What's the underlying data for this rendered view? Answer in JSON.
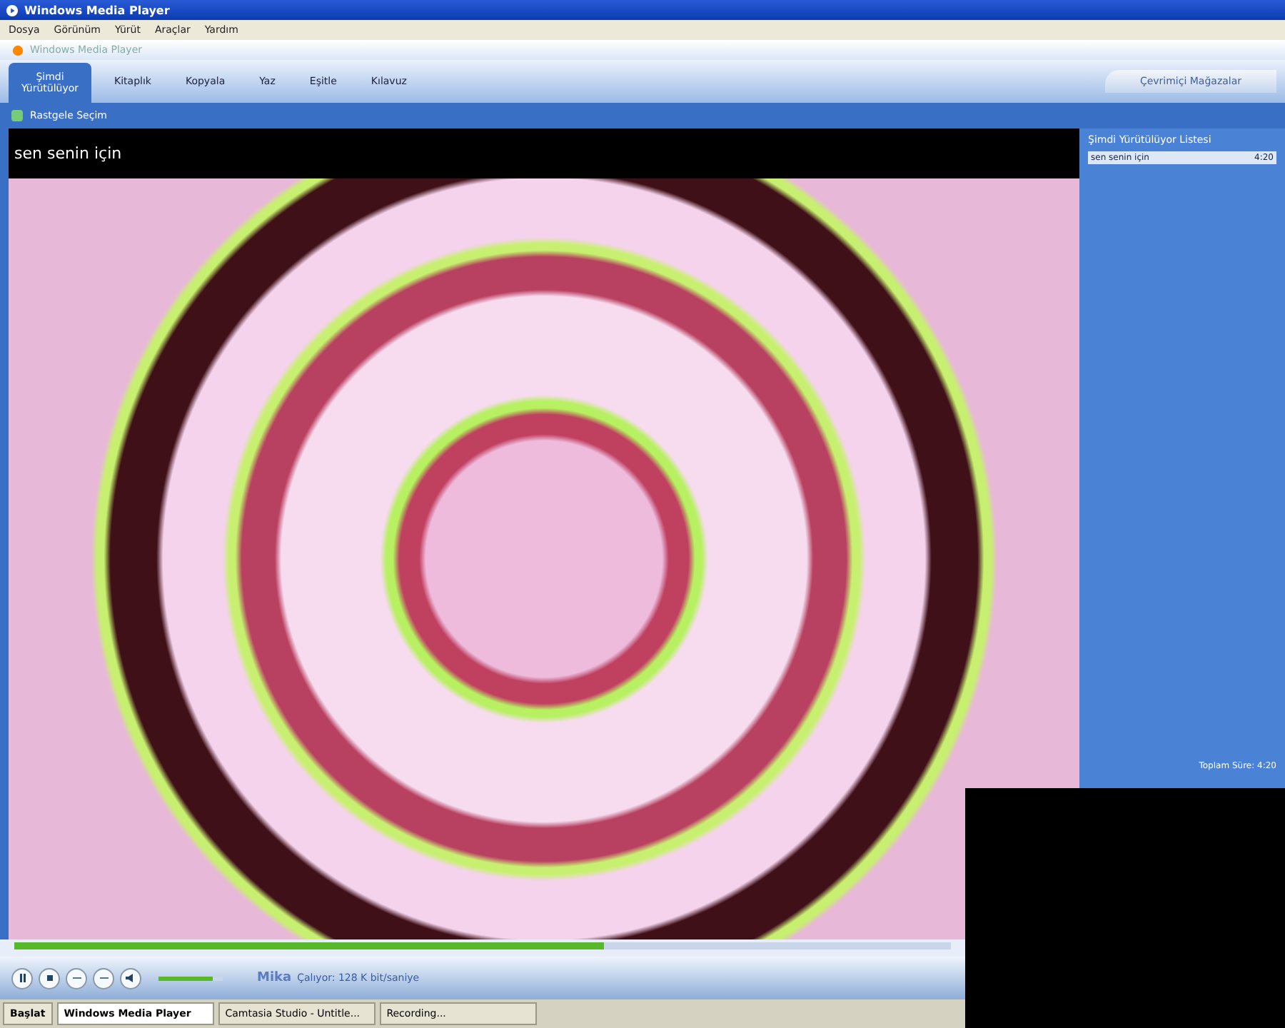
{
  "window": {
    "title": "Windows Media Player"
  },
  "menu": [
    "Dosya",
    "Görünüm",
    "Yürüt",
    "Araçlar",
    "Yardım"
  ],
  "player_title": "Windows Media Player",
  "tabs": [
    {
      "label": "Şimdi Yürütülüyor",
      "selected": true
    },
    {
      "label": "Kitaplık",
      "selected": false
    },
    {
      "label": "Kopyala",
      "selected": false
    },
    {
      "label": "Yaz",
      "selected": false
    },
    {
      "label": "Eşitle",
      "selected": false
    },
    {
      "label": "Kılavuz",
      "selected": false
    }
  ],
  "store_tab": {
    "label": "Çevrimiçi Mağazalar"
  },
  "toolbar": {
    "shuffle_label": "Rastgele Seçim"
  },
  "video": {
    "caption": "sen senin için"
  },
  "playlist": {
    "title": "Şimdi Yürütülüyor Listesi",
    "items": [
      {
        "name": "sen senin için",
        "duration": "4:20",
        "selected": true
      }
    ],
    "total": "Toplam Süre: 4:20"
  },
  "seek": {
    "level": 0.63
  },
  "volume": {
    "level": 0.85
  },
  "status": {
    "artist": "Mika",
    "text": "Çalıyor: 128 K bit/saniye"
  },
  "taskbar": {
    "start": "Başlat",
    "items": [
      {
        "label": "Windows Media Player",
        "selected": true
      },
      {
        "label": "Camtasia Studio - Untitle...",
        "selected": false
      },
      {
        "label": "Recording...",
        "selected": false
      }
    ]
  }
}
